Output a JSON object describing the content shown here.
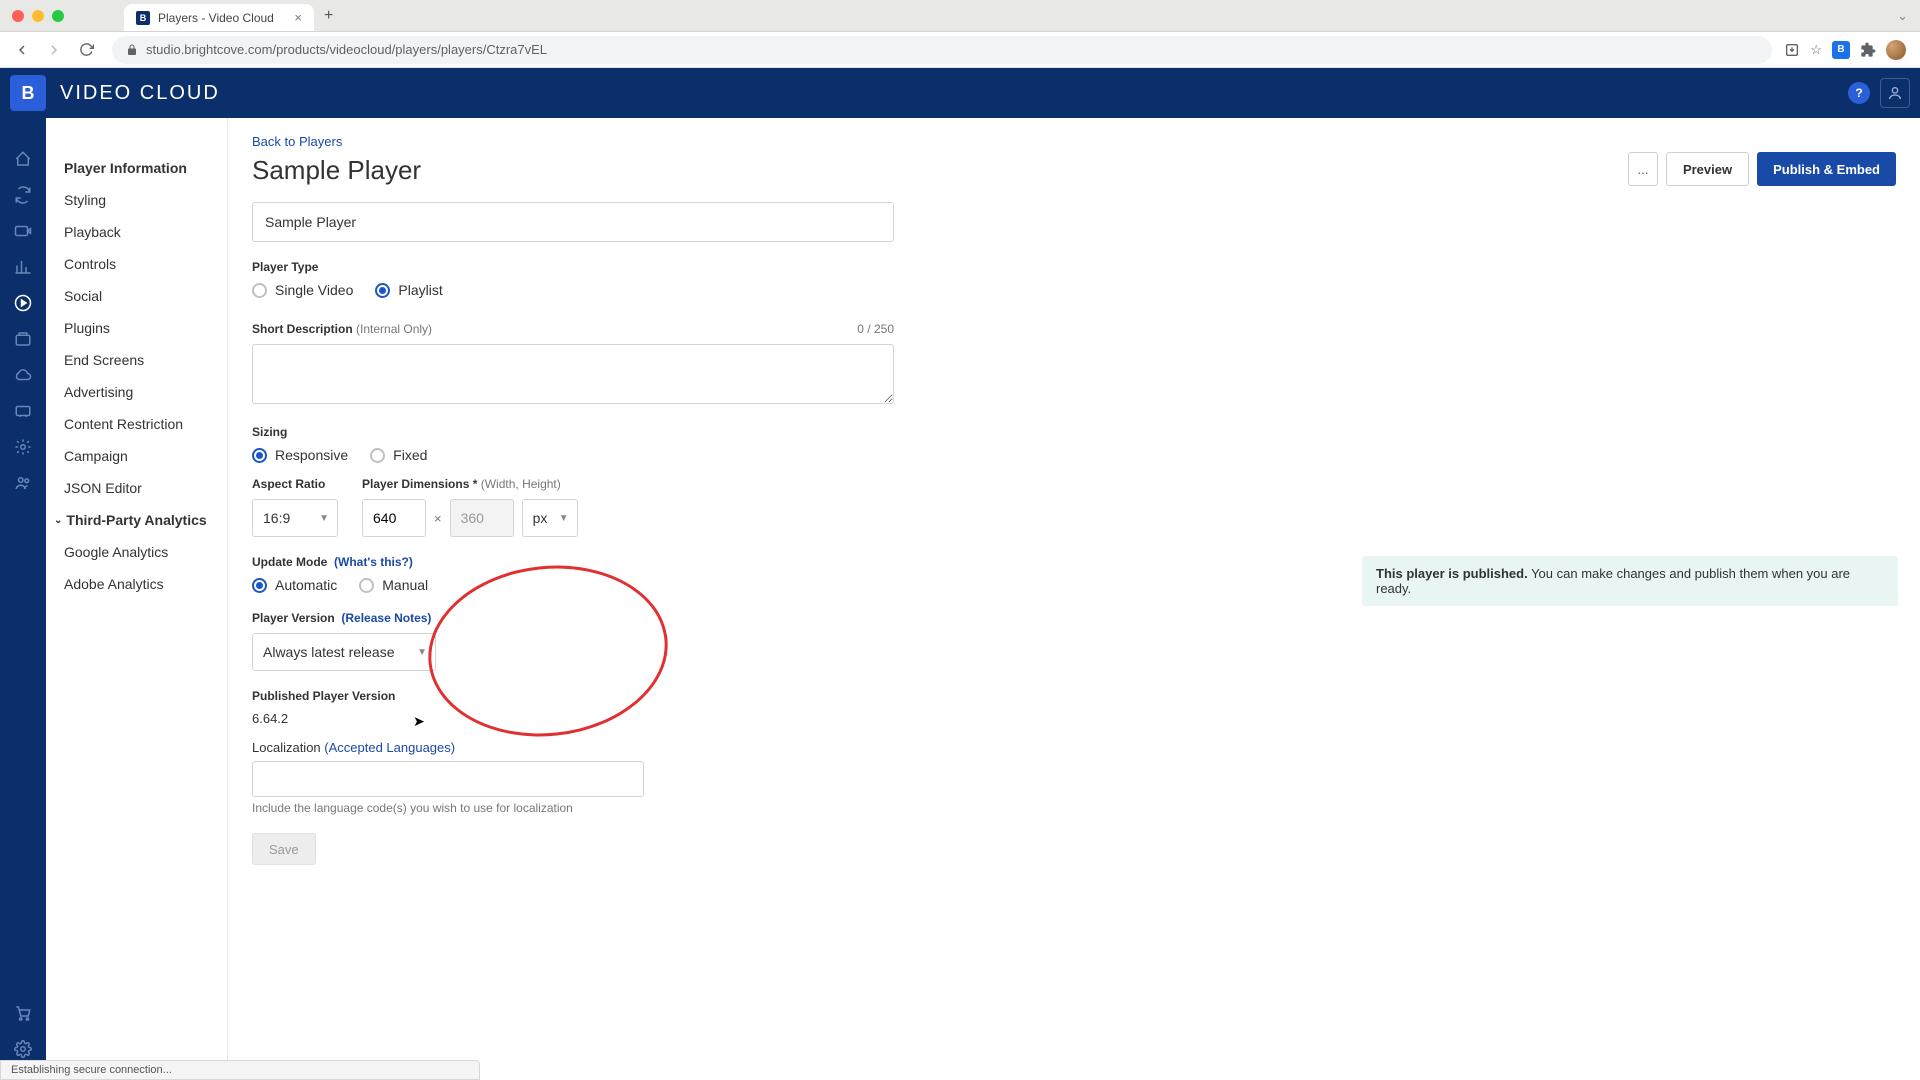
{
  "browser": {
    "tab_title": "Players - Video Cloud",
    "url": "studio.brightcove.com/products/videocloud/players/players/Ctzra7vEL",
    "status_text": "Establishing secure connection..."
  },
  "app": {
    "title": "VIDEO CLOUD",
    "logo_letter": "B"
  },
  "sidebar": {
    "items": [
      "Player Information",
      "Styling",
      "Playback",
      "Controls",
      "Social",
      "Plugins",
      "End Screens",
      "Advertising",
      "Content Restriction",
      "Campaign",
      "JSON Editor"
    ],
    "group_label": "Third-Party Analytics",
    "subitems": [
      "Google Analytics",
      "Adobe Analytics"
    ]
  },
  "header": {
    "back_link": "Back to Players",
    "page_title": "Sample Player",
    "more_label": "...",
    "preview_label": "Preview",
    "publish_label": "Publish & Embed"
  },
  "form": {
    "name_value": "Sample Player",
    "player_type_label": "Player Type",
    "player_type_options": [
      "Single Video",
      "Playlist"
    ],
    "player_type_selected": "Playlist",
    "short_desc_label": "Short Description",
    "short_desc_hint": "(Internal Only)",
    "short_desc_counter": "0 / 250",
    "sizing_label": "Sizing",
    "sizing_options": [
      "Responsive",
      "Fixed"
    ],
    "sizing_selected": "Responsive",
    "aspect_ratio_label": "Aspect Ratio",
    "aspect_ratio_value": "16:9",
    "dimensions_label": "Player Dimensions *",
    "dimensions_hint": "(Width, Height)",
    "width_value": "640",
    "height_value": "360",
    "unit_value": "px",
    "update_mode_label": "Update Mode",
    "update_mode_link": "(What's this?)",
    "update_mode_options": [
      "Automatic",
      "Manual"
    ],
    "update_mode_selected": "Automatic",
    "player_version_label": "Player Version",
    "player_version_link": "(Release Notes)",
    "player_version_value": "Always latest release",
    "published_version_label": "Published Player Version",
    "published_version_value": "6.64.2",
    "localization_label": "Localization",
    "localization_link": "(Accepted Languages)",
    "localization_hint": "Include the language code(s) you wish to use for localization",
    "save_label": "Save"
  },
  "status": {
    "strong": "This player is published.",
    "rest": " You can make changes and publish them when you are ready."
  }
}
